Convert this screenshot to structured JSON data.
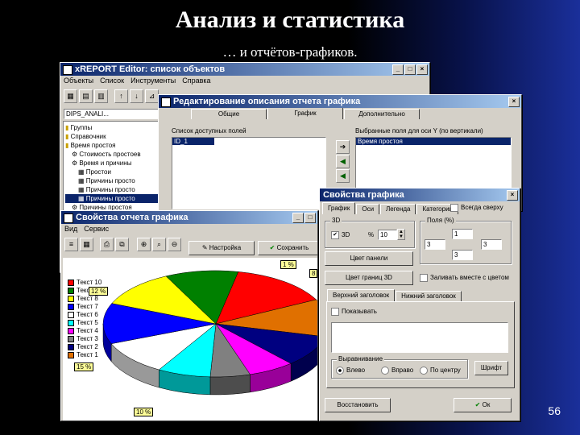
{
  "slide": {
    "title": "Анализ и статистика",
    "subtitle": "… и отчётов-графиков.",
    "page_number": "56"
  },
  "colors": {
    "accent": "#0a246a",
    "window_bg": "#d4d0c8"
  },
  "main_window": {
    "title": "xREPORT Editor: список объектов",
    "menu": [
      "Объекты",
      "Список",
      "Инструменты",
      "Справка"
    ],
    "combo_value": "DIPS_ANALI...",
    "tree": [
      "Группы",
      "Справочник",
      "Время простоя",
      "Стоимость простоев",
      "Время и причины",
      "Простои",
      "Причины просто",
      "Причины просто",
      "Причины просто",
      "Причины простоя"
    ]
  },
  "edit_window": {
    "title": "Редактирование описания отчета графика",
    "tabs": [
      "Общие",
      "График",
      "Дополнительно"
    ],
    "list_left_label": "Список доступных полей",
    "list_left_items": [
      "ID_1"
    ],
    "list_right_label": "Выбранные поля для оси Y (по вертикали)",
    "list_right_items": [
      "Время простоя"
    ]
  },
  "report_window": {
    "title": "Свойства отчета графика",
    "menu": [
      "Вид",
      "Сервис"
    ],
    "settings_button": "Настройка",
    "save_button": "Сохранить",
    "legend": [
      "Текст 10",
      "Текст 9",
      "Текст 8",
      "Текст 7",
      "Текст 6",
      "Текст 5",
      "Текст 4",
      "Текст 3",
      "Текст 2",
      "Текст 1"
    ]
  },
  "props_window": {
    "title": "Свойства графика",
    "tabs": [
      "График",
      "Оси",
      "Легенда",
      "Категории"
    ],
    "always_on_top_label": "Всегда сверху",
    "group_3d_label": "3D",
    "chk_3d_label": "3D",
    "percent_symbol": "%",
    "percent_value": "10",
    "margins_label": "Поля (%)",
    "margin_top": "1",
    "margin_left": "3",
    "margin_right": "3",
    "margin_bottom": "3",
    "panel_color_button": "Цвет панели",
    "bg_color_button": "Цвет границ 3D",
    "transparent_label": "Заливать вместе с цветом",
    "header_tabs": [
      "Верхний заголовок",
      "Нижний заголовок"
    ],
    "show_label": "Показывать",
    "align_label": "Выравнивание",
    "align_options": [
      "Влево",
      "Вправо",
      "По центру"
    ],
    "font_button": "Шрифт",
    "apply_button": "Восстановить",
    "ok_button": "Ок"
  },
  "chart_data": {
    "type": "pie",
    "categories": [
      "Текст 1",
      "Текст 2",
      "Текст 3",
      "Текст 4",
      "Текст 5",
      "Текст 6",
      "Текст 7",
      "Текст 8",
      "Текст 9",
      "Текст 10"
    ],
    "values": [
      15,
      12,
      10,
      7,
      6,
      8,
      11,
      13,
      12,
      11
    ],
    "colors": [
      "#ff0000",
      "#e07000",
      "#000080",
      "#ff00ff",
      "#808080",
      "#00ffff",
      "#ffffff",
      "#0000ff",
      "#ffff00",
      "#008000"
    ],
    "data_labels": [
      "1 %",
      "12 %",
      "15 %",
      "10 %",
      "8"
    ],
    "title": "",
    "xlabel": "",
    "ylabel": ""
  }
}
